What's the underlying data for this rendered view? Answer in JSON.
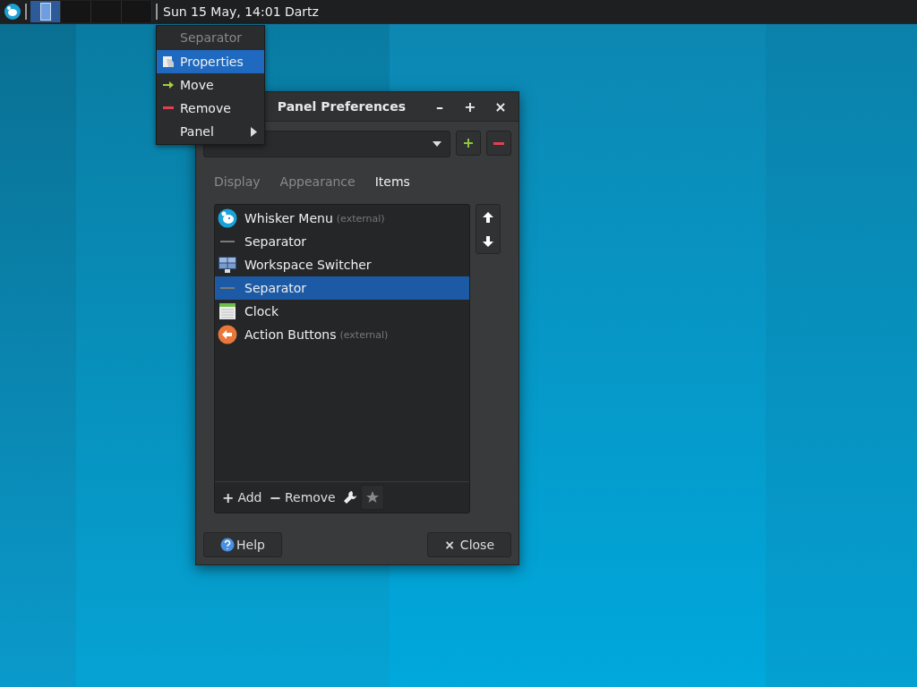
{
  "top_panel": {
    "clock": "Sun 15 May, 14:01 Dartz",
    "workspaces": [
      {
        "selected": true
      },
      {
        "selected": false
      },
      {
        "selected": false
      },
      {
        "selected": false
      }
    ]
  },
  "context_menu": {
    "header": "Separator",
    "items": [
      {
        "label": "Properties",
        "kind": "properties",
        "selected": true,
        "submenu": false
      },
      {
        "label": "Move",
        "kind": "move",
        "selected": false,
        "submenu": false
      },
      {
        "label": "Remove",
        "kind": "remove",
        "selected": false,
        "submenu": false
      },
      {
        "label": "Panel",
        "kind": "none",
        "selected": false,
        "submenu": true
      }
    ]
  },
  "window": {
    "title": "Panel Preferences",
    "controls": [
      "–",
      "+",
      "×"
    ],
    "tabs": [
      {
        "label": "Display",
        "selected": false
      },
      {
        "label": "Appearance",
        "selected": false
      },
      {
        "label": "Items",
        "selected": true
      }
    ],
    "items": [
      {
        "label": "Whisker Menu",
        "note": "(external)",
        "kind": "whisker",
        "selected": false
      },
      {
        "label": "Separator",
        "kind": "separator",
        "selected": false
      },
      {
        "label": "Workspace Switcher",
        "kind": "workspace",
        "selected": false
      },
      {
        "label": "Separator",
        "kind": "separator",
        "selected": true
      },
      {
        "label": "Clock",
        "kind": "clock",
        "selected": false
      },
      {
        "label": "Action Buttons",
        "note": "(external)",
        "kind": "action",
        "selected": false
      }
    ],
    "list_buttons": [
      {
        "label": "Add",
        "icon": "+"
      },
      {
        "label": "Remove",
        "icon": "−"
      }
    ],
    "help": "Help",
    "close": "Close",
    "close_icon": "×"
  }
}
